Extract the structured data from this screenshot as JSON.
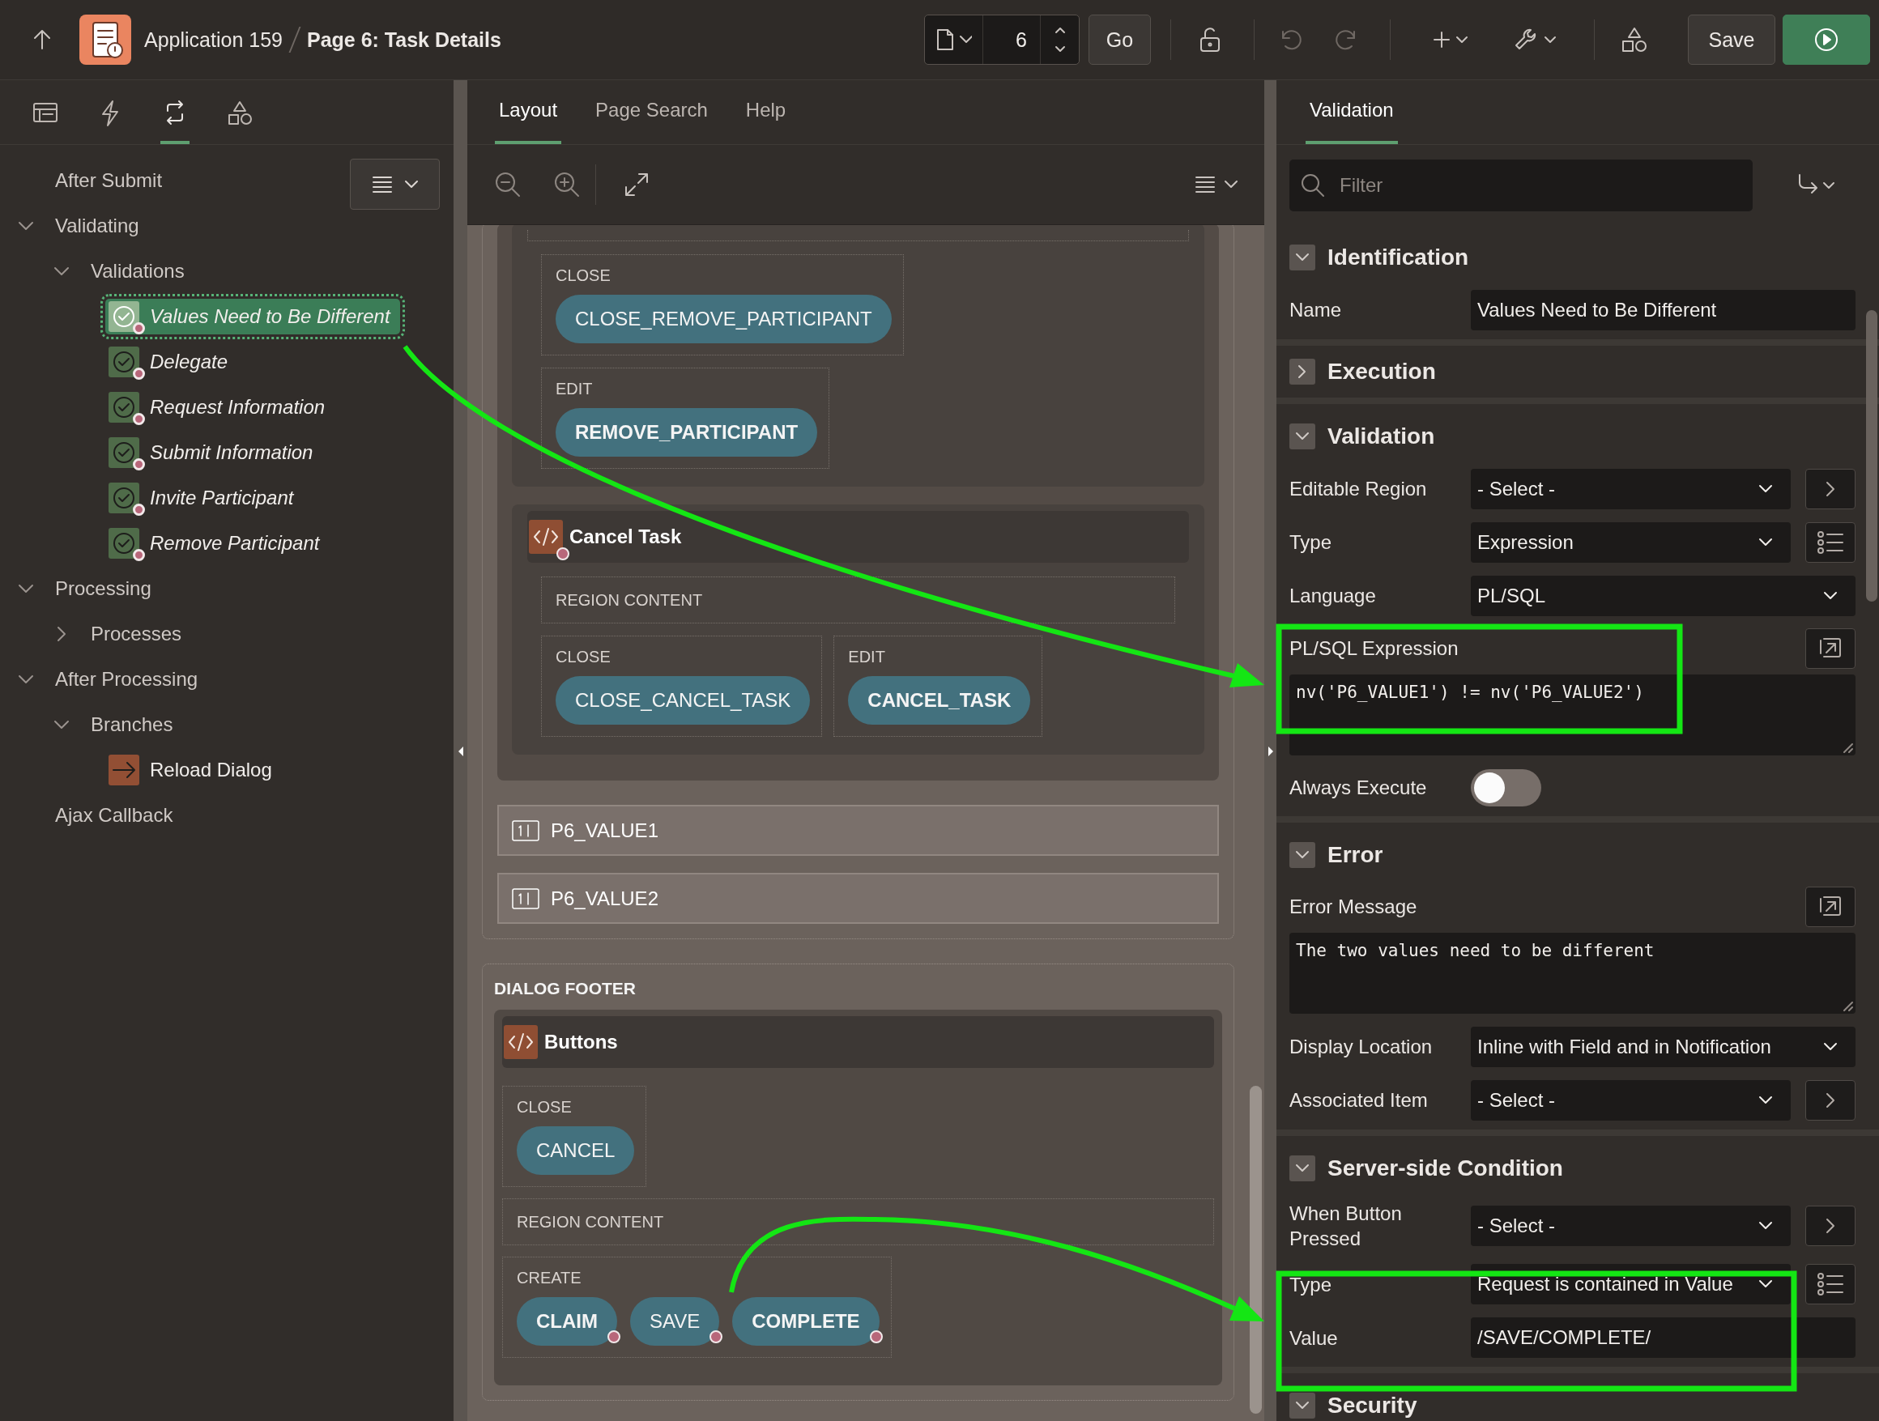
{
  "header": {
    "app_name": "Application 159",
    "page_title": "Page 6: Task Details",
    "page_number": "6",
    "go_label": "Go",
    "save_label": "Save"
  },
  "left_panel": {
    "tabs": [
      {
        "kind": "rendering",
        "selected": false
      },
      {
        "kind": "dynamic-actions",
        "selected": false
      },
      {
        "kind": "processing",
        "selected": true
      },
      {
        "kind": "shared",
        "selected": false
      }
    ],
    "tree": [
      {
        "kind": "heading",
        "label": "After Submit"
      },
      {
        "kind": "folder",
        "label": "Validating",
        "expanded": true,
        "children": [
          {
            "kind": "folder",
            "label": "Validations",
            "expanded": true,
            "children": [
              {
                "kind": "validation",
                "label": "Values Need to Be Different",
                "selected": true,
                "condition": true
              },
              {
                "kind": "validation",
                "label": "Delegate",
                "selected": false,
                "condition": true
              },
              {
                "kind": "validation",
                "label": "Request Information",
                "selected": false,
                "condition": true
              },
              {
                "kind": "validation",
                "label": "Submit Information",
                "selected": false,
                "condition": true
              },
              {
                "kind": "validation",
                "label": "Invite Participant",
                "selected": false,
                "condition": true
              },
              {
                "kind": "validation",
                "label": "Remove Participant",
                "selected": false,
                "condition": true
              }
            ]
          }
        ]
      },
      {
        "kind": "folder",
        "label": "Processing",
        "expanded": true,
        "children": [
          {
            "kind": "folder",
            "label": "Processes",
            "expanded": false
          }
        ]
      },
      {
        "kind": "folder",
        "label": "After Processing",
        "expanded": true,
        "children": [
          {
            "kind": "folder",
            "label": "Branches",
            "expanded": true,
            "children": [
              {
                "kind": "branch",
                "label": "Reload Dialog"
              }
            ]
          }
        ]
      },
      {
        "kind": "heading",
        "label": "Ajax Callback"
      }
    ]
  },
  "layout": {
    "tabs": [
      {
        "label": "Layout",
        "selected": true
      },
      {
        "label": "Page Search",
        "selected": false
      },
      {
        "label": "Help",
        "selected": false
      }
    ],
    "regions": [
      {
        "kind": "continued",
        "rows": [
          [
            {
              "position": "CLOSE",
              "buttons": [
                {
                  "label": "CLOSE_REMOVE_PARTICIPANT",
                  "hot": false,
                  "condition": false
                }
              ]
            }
          ],
          [
            {
              "position": "EDIT",
              "buttons": [
                {
                  "label": "REMOVE_PARTICIPANT",
                  "hot": true,
                  "condition": false
                }
              ]
            }
          ]
        ]
      },
      {
        "kind": "titled",
        "title": "Cancel Task",
        "condition": true,
        "rows": [
          [
            {
              "position": "REGION CONTENT"
            }
          ],
          [
            {
              "position": "CLOSE",
              "buttons": [
                {
                  "label": "CLOSE_CANCEL_TASK",
                  "hot": false,
                  "condition": false
                }
              ]
            },
            {
              "position": "EDIT",
              "buttons": [
                {
                  "label": "CANCEL_TASK",
                  "hot": true,
                  "condition": false
                }
              ]
            }
          ]
        ]
      }
    ],
    "items": [
      {
        "label": "P6_VALUE1"
      },
      {
        "label": "P6_VALUE2"
      }
    ],
    "footer": {
      "title": "DIALOG FOOTER",
      "region": {
        "kind": "titled",
        "title": "Buttons",
        "condition": false,
        "rows": [
          [
            {
              "position": "CLOSE",
              "buttons": [
                {
                  "label": "CANCEL",
                  "hot": false,
                  "condition": false
                }
              ]
            }
          ],
          [
            {
              "position": "REGION CONTENT"
            }
          ],
          [
            {
              "position": "CREATE",
              "buttons": [
                {
                  "label": "CLAIM",
                  "hot": true,
                  "condition": true
                },
                {
                  "label": "SAVE",
                  "hot": false,
                  "condition": true
                },
                {
                  "label": "COMPLETE",
                  "hot": true,
                  "condition": true
                }
              ]
            }
          ]
        ]
      }
    }
  },
  "properties": {
    "tabs": [
      {
        "label": "Validation",
        "selected": true
      }
    ],
    "filter": {
      "placeholder": "Filter"
    },
    "sections": [
      {
        "title": "Identification",
        "expanded": true,
        "props": [
          {
            "label": "Name",
            "kind": "text",
            "value": "Values Need to Be Different"
          }
        ]
      },
      {
        "title": "Execution",
        "expanded": false
      },
      {
        "title": "Validation",
        "expanded": true,
        "props": [
          {
            "label": "Editable Region",
            "kind": "select",
            "value": "- Select -",
            "button": {
              "kind": "link"
            }
          },
          {
            "label": "Type",
            "kind": "select",
            "value": "Expression",
            "button": {
              "kind": "list"
            }
          },
          {
            "label": "Language",
            "kind": "select",
            "value": "PL/SQL"
          },
          {
            "label": "PL/SQL Expression",
            "kind": "code",
            "value": "nv('P6_VALUE1') != nv('P6_VALUE2')",
            "button": {
              "kind": "popout"
            }
          },
          {
            "label": "Always Execute",
            "kind": "switch",
            "on": false
          }
        ]
      },
      {
        "title": "Error",
        "expanded": true,
        "props": [
          {
            "label": "Error Message",
            "kind": "code",
            "value": "The two values need to be different",
            "button": {
              "kind": "popout"
            }
          },
          {
            "label": "Display Location",
            "kind": "select",
            "value": "Inline with Field and in Notification"
          },
          {
            "label": "Associated Item",
            "kind": "select",
            "value": "- Select -",
            "button": {
              "kind": "link"
            }
          }
        ]
      },
      {
        "title": "Server-side Condition",
        "expanded": true,
        "props": [
          {
            "label": "When Button Pressed",
            "kind": "select",
            "value": "- Select -",
            "button": {
              "kind": "link"
            }
          },
          {
            "label": "Type",
            "kind": "select",
            "value": "Request is contained in Value",
            "button": {
              "kind": "list"
            }
          },
          {
            "label": "Value",
            "kind": "text",
            "value": "/SAVE/COMPLETE/"
          }
        ]
      },
      {
        "title": "Security",
        "expanded": true
      }
    ]
  }
}
